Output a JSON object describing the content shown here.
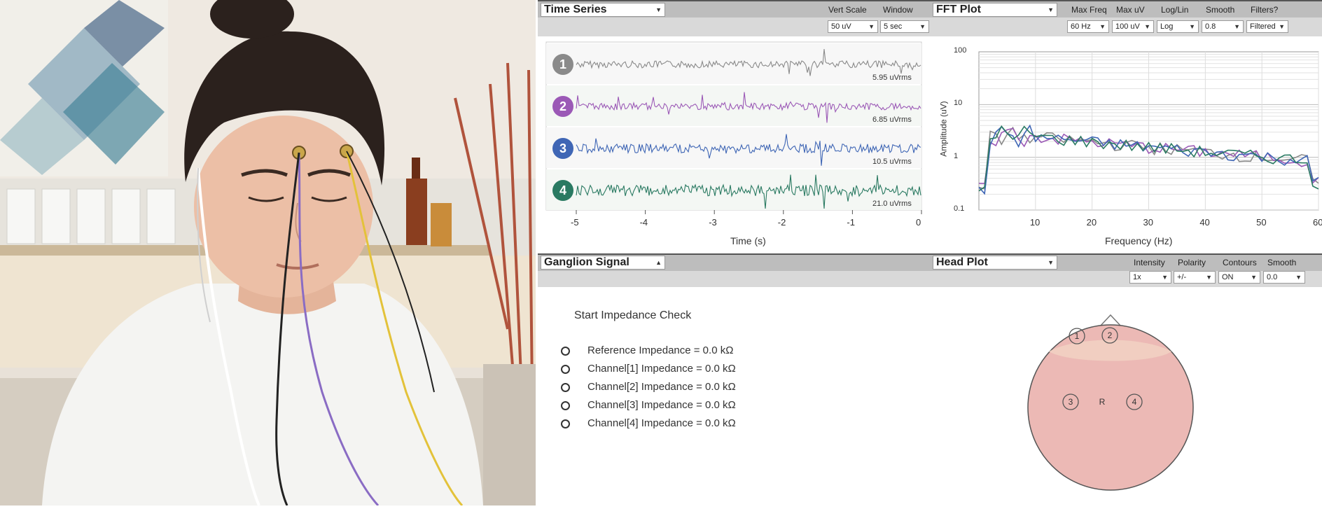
{
  "time_series": {
    "title": "Time Series",
    "vert_scale_label": "Vert Scale",
    "vert_scale_value": "50 uV",
    "window_label": "Window",
    "window_value": "5 sec",
    "channels": [
      {
        "num": "1",
        "rms": "5.95 uVrms",
        "color": "#8a8a8a"
      },
      {
        "num": "2",
        "rms": "6.85 uVrms",
        "color": "#9b59b6"
      },
      {
        "num": "3",
        "rms": "10.5 uVrms",
        "color": "#3f66b5"
      },
      {
        "num": "4",
        "rms": "21.0 uVrms",
        "color": "#2a7a62"
      }
    ],
    "x_ticks": [
      "-5",
      "-4",
      "-3",
      "-2",
      "-1",
      "0"
    ],
    "x_label": "Time (s)"
  },
  "fft": {
    "title": "FFT Plot",
    "controls": [
      {
        "label": "Max Freq",
        "value": "60 Hz"
      },
      {
        "label": "Max uV",
        "value": "100 uV"
      },
      {
        "label": "Log/Lin",
        "value": "Log"
      },
      {
        "label": "Smooth",
        "value": "0.8"
      },
      {
        "label": "Filters?",
        "value": "Filtered"
      }
    ],
    "y_ticks": [
      "100",
      "10",
      "1",
      "0.1"
    ],
    "x_ticks": [
      "10",
      "20",
      "30",
      "40",
      "50",
      "60"
    ],
    "y_label": "Amplitude (uV)",
    "x_label": "Frequency (Hz)"
  },
  "ganglion": {
    "title": "Ganglion Signal",
    "check_label": "Start Impedance Check",
    "rows": [
      "Reference Impedance = 0.0 kΩ",
      "Channel[1] Impedance = 0.0 kΩ",
      "Channel[2] Impedance = 0.0 kΩ",
      "Channel[3] Impedance = 0.0 kΩ",
      "Channel[4] Impedance = 0.0 kΩ"
    ]
  },
  "head_plot": {
    "title": "Head Plot",
    "controls": [
      {
        "label": "Intensity",
        "value": "1x"
      },
      {
        "label": "Polarity",
        "value": "+/-"
      },
      {
        "label": "Contours",
        "value": "ON"
      },
      {
        "label": "Smooth",
        "value": "0.0"
      }
    ],
    "electrodes": [
      "1",
      "2",
      "3",
      "4"
    ],
    "ref_label": "R"
  }
}
